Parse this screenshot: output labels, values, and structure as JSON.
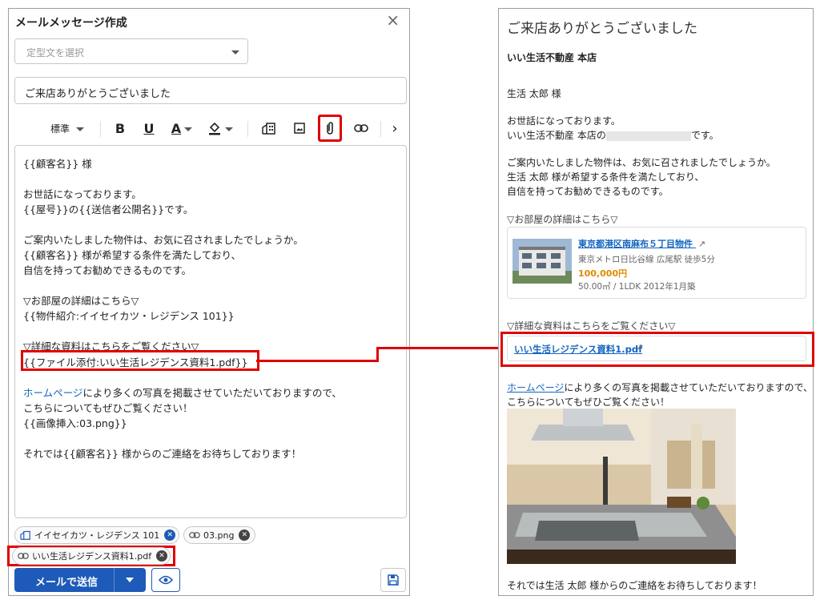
{
  "compose": {
    "title": "メールメッセージ作成",
    "close_glyph": "×",
    "template_placeholder": "定型文を選択",
    "subject": "ご来店ありがとうございました",
    "toolbar": {
      "format_label": "標準",
      "bold": "B",
      "underline": "U",
      "font_color": "A",
      "more": "›"
    },
    "body_lines": [
      "{{顧客名}} 様",
      "",
      "お世話になっております。",
      "{{屋号}}の{{送信者公開名}}です。",
      "",
      "ご案内いたしました物件は、お気に召されましたでしょうか。",
      "{{顧客名}} 様が希望する条件を満たしており、",
      "自信を持ってお勧めできるものです。",
      "",
      "▽お部屋の詳細はこちら▽",
      "{{物件紹介:イイセイカツ・レジデンス 101}}",
      "",
      "▽詳細な資料はこちらをご覧ください▽",
      "{{ファイル添付:いい生活レジデンス資料1.pdf}}",
      "",
      "ホームページ",
      "により多くの写真を掲載させていただいておりますので、",
      "こちらについてもぜひご覧ください！",
      "{{画像挿入:03.png}}",
      "",
      "それでは{{顧客名}} 様からのご連絡をお待ちしております！"
    ],
    "chips": [
      {
        "label": "イイセイカツ・レジデンス 101",
        "icon": "building-icon"
      },
      {
        "label": "03.png",
        "icon": "link-icon"
      },
      {
        "label": "いい生活レジデンス資料1.pdf",
        "icon": "link-icon"
      }
    ],
    "send_label": "メールで送信"
  },
  "preview": {
    "subject": "ご来店ありがとうございました",
    "store": "いい生活不動産 本店",
    "greeting": "生活 太郎 様",
    "intro1": "お世話になっております。",
    "intro2_prefix": "いい生活不動産 本店の",
    "intro2_suffix": "です。",
    "para1": "ご案内いたしました物件は、お気に召されましたでしょうか。",
    "para2": "生活 太郎 様が希望する条件を満たしており、",
    "para3": "自信を持ってお勧めできるものです。",
    "room_heading": "▽お部屋の詳細はこちら▽",
    "property": {
      "name": "東京都港区南麻布５丁目物件",
      "access": "東京メトロ日比谷線 広尾駅 徒歩5分",
      "price": "100,000円",
      "spec": "50.00㎡ / 1LDK 2012年1月築"
    },
    "doc_heading": "▽詳細な資料はこちらをご覧ください▽",
    "file_link": "いい生活レジデンス資料1.pdf",
    "hp_link": "ホームページ",
    "hp_text": "により多くの写真を掲載させていただいておりますので、",
    "hp_text2": "こちらについてもぜひご覧ください！",
    "closing": "それでは生活 太郎 様からのご連絡をお待ちしております！"
  },
  "colors": {
    "accent": "#1e5bb8",
    "link": "#1565c0",
    "price": "#e08a00",
    "highlight": "#e00000"
  }
}
